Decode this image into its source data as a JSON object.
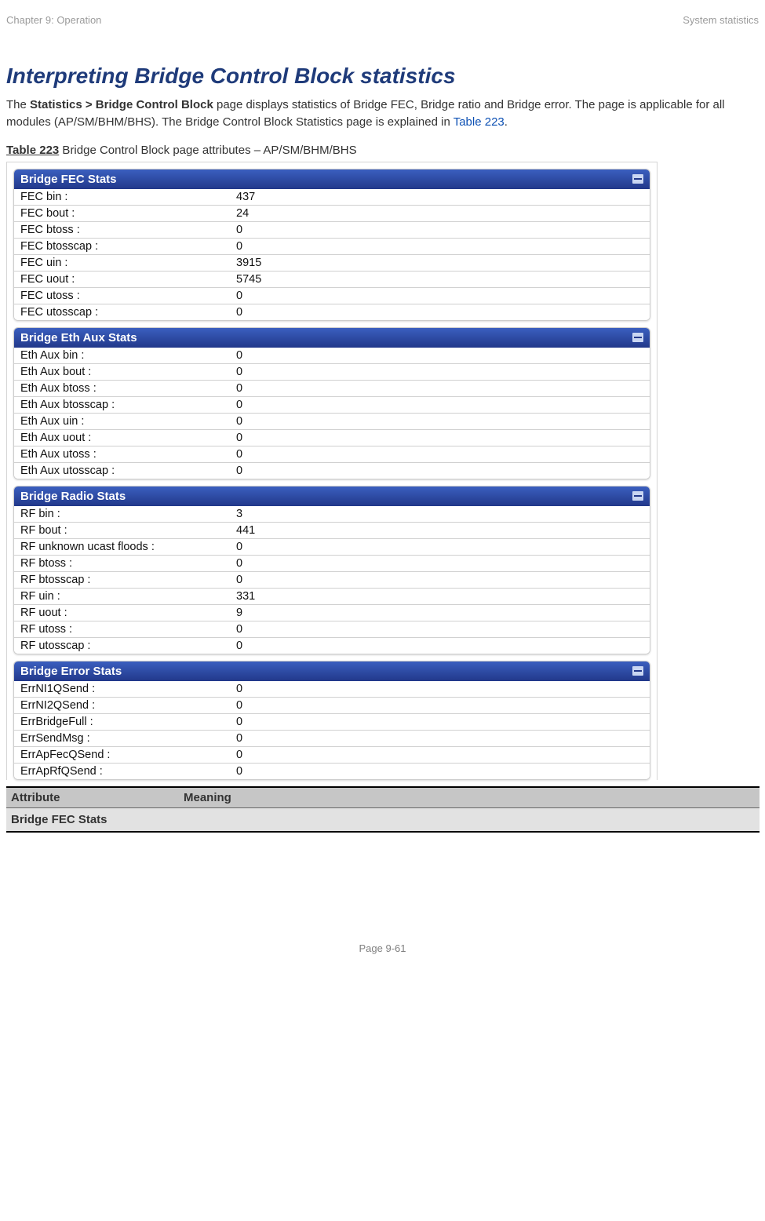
{
  "header": {
    "left": "Chapter 9:  Operation",
    "right": "System statistics"
  },
  "title": "Interpreting Bridge Control Block statistics",
  "intro": {
    "pre": "The ",
    "strong": "Statistics > Bridge Control Block",
    "mid": " page displays statistics of Bridge FEC, Bridge ratio and Bridge error. The page is applicable for all modules (AP/SM/BHM/BHS). The Bridge Control Block Statistics page is explained in ",
    "link": "Table 223",
    "end": "."
  },
  "caption": {
    "strong": "Table 223",
    "rest": " Bridge Control Block page attributes – AP/SM/BHM/BHS"
  },
  "panels": [
    {
      "title": "Bridge FEC Stats",
      "rows": [
        {
          "label": "FEC bin :",
          "value": "437"
        },
        {
          "label": "FEC bout :",
          "value": "24"
        },
        {
          "label": "FEC btoss :",
          "value": "0"
        },
        {
          "label": "FEC btosscap :",
          "value": "0"
        },
        {
          "label": "FEC uin :",
          "value": "3915"
        },
        {
          "label": "FEC uout :",
          "value": "5745"
        },
        {
          "label": "FEC utoss :",
          "value": "0"
        },
        {
          "label": "FEC utosscap :",
          "value": "0"
        }
      ]
    },
    {
      "title": "Bridge Eth Aux Stats",
      "rows": [
        {
          "label": "Eth Aux bin :",
          "value": "0"
        },
        {
          "label": "Eth Aux bout :",
          "value": "0"
        },
        {
          "label": "Eth Aux btoss :",
          "value": "0"
        },
        {
          "label": "Eth Aux btosscap :",
          "value": "0"
        },
        {
          "label": "Eth Aux uin :",
          "value": "0"
        },
        {
          "label": "Eth Aux uout :",
          "value": "0"
        },
        {
          "label": "Eth Aux utoss :",
          "value": "0"
        },
        {
          "label": "Eth Aux utosscap :",
          "value": "0"
        }
      ]
    },
    {
      "title": "Bridge Radio Stats",
      "rows": [
        {
          "label": "RF bin :",
          "value": "3"
        },
        {
          "label": "RF bout :",
          "value": "441"
        },
        {
          "label": "RF unknown ucast floods :",
          "value": "0"
        },
        {
          "label": "RF btoss :",
          "value": "0"
        },
        {
          "label": "RF btosscap :",
          "value": "0"
        },
        {
          "label": "RF uin :",
          "value": "331"
        },
        {
          "label": "RF uout :",
          "value": "9"
        },
        {
          "label": "RF utoss :",
          "value": "0"
        },
        {
          "label": "RF utosscap :",
          "value": "0"
        }
      ]
    },
    {
      "title": "Bridge Error Stats",
      "rows": [
        {
          "label": "ErrNI1QSend :",
          "value": "0"
        },
        {
          "label": "ErrNI2QSend :",
          "value": "0"
        },
        {
          "label": "ErrBridgeFull :",
          "value": "0"
        },
        {
          "label": "ErrSendMsg :",
          "value": "0"
        },
        {
          "label": "ErrApFecQSend :",
          "value": "0"
        },
        {
          "label": "ErrApRfQSend :",
          "value": "0"
        }
      ]
    }
  ],
  "attrTable": {
    "cols": [
      "Attribute",
      "Meaning"
    ],
    "section": "Bridge FEC Stats"
  },
  "footer": "Page 9-61"
}
